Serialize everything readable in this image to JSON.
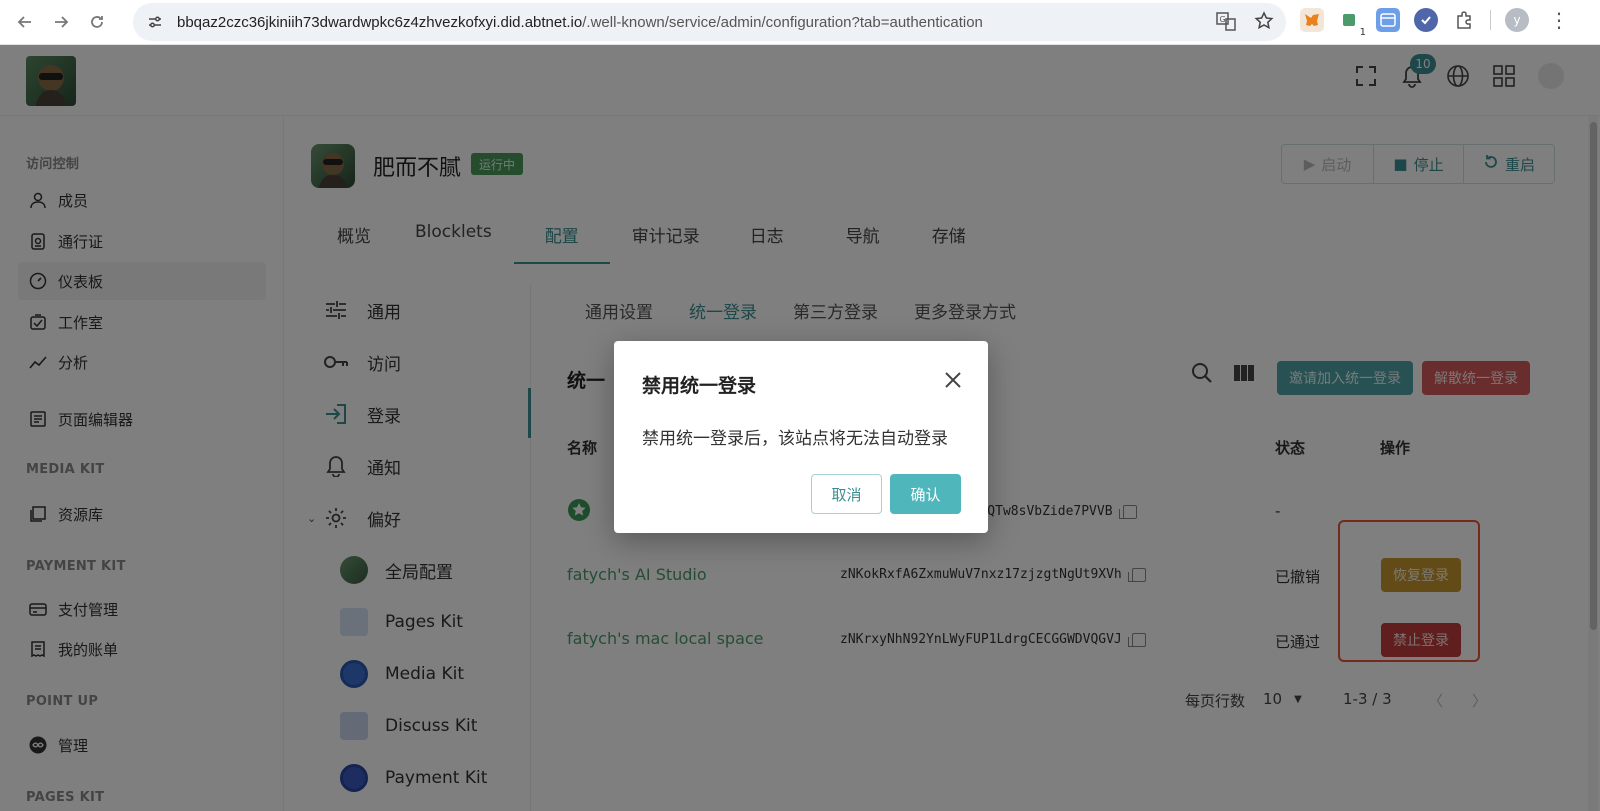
{
  "browser": {
    "url_host": "bbqaz2czc36jkiniih73dwardwpkc6z4zhvezkofxyi.did.abtnet.io",
    "url_path": "/.well-known/service/admin/configuration?tab=authentication",
    "profile_initial": "y",
    "ext_badge": "1"
  },
  "header": {
    "notification_count": "10"
  },
  "sidebar": {
    "sections": [
      {
        "title": "访问控制"
      },
      {
        "title": "MEDIA KIT"
      },
      {
        "title": "PAYMENT KIT"
      },
      {
        "title": "POINT UP"
      },
      {
        "title": "PAGES KIT"
      }
    ],
    "items": [
      {
        "label": "成员"
      },
      {
        "label": "通行证"
      },
      {
        "label": "仪表板"
      },
      {
        "label": "工作室"
      },
      {
        "label": "分析"
      },
      {
        "label": "页面编辑器"
      },
      {
        "label": "资源库"
      },
      {
        "label": "支付管理"
      },
      {
        "label": "我的账单"
      },
      {
        "label": "管理"
      }
    ]
  },
  "blocklet": {
    "title": "肥而不腻",
    "status": "运行中",
    "start_label": "启动",
    "stop_label": "停止",
    "restart_label": "重启"
  },
  "main_tabs": [
    {
      "label": "概览"
    },
    {
      "label": "Blocklets"
    },
    {
      "label": "配置"
    },
    {
      "label": "审计记录"
    },
    {
      "label": "日志"
    },
    {
      "label": "导航"
    },
    {
      "label": "存储"
    }
  ],
  "config_menu": {
    "items": [
      {
        "label": "通用"
      },
      {
        "label": "访问"
      },
      {
        "label": "登录"
      },
      {
        "label": "通知"
      },
      {
        "label": "偏好"
      }
    ],
    "sub_items": [
      {
        "label": "全局配置"
      },
      {
        "label": "Pages Kit"
      },
      {
        "label": "Media Kit"
      },
      {
        "label": "Discuss Kit"
      },
      {
        "label": "Payment Kit"
      }
    ]
  },
  "sub_tabs": [
    {
      "label": "通用设置"
    },
    {
      "label": "统一登录"
    },
    {
      "label": "第三方登录"
    },
    {
      "label": "更多登录方式"
    }
  ],
  "table": {
    "title_partial": "统一",
    "buttons": {
      "invite": "邀请加入统一登录",
      "dismiss": "解散统一登录"
    },
    "headers": {
      "name": "名称",
      "status": "状态",
      "actions": "操作"
    },
    "rows": [
      {
        "name": "",
        "did": "chXzQTw8sVbZide7PVVB",
        "status": "-",
        "action": ""
      },
      {
        "name": "fatych's AI Studio",
        "did": "zNKokRxfA6ZxmuWuV7nxz17zjzgtNgUt9XVh",
        "status": "已撤销",
        "action": "恢复登录"
      },
      {
        "name": "fatych's mac local space",
        "did": "zNKrxyNhN92YnLWyFUP1LdrgCECGGWDVQGVJ",
        "status": "已通过",
        "action": "禁止登录"
      }
    ],
    "pager": {
      "rows_per_page_label": "每页行数",
      "rows_per_page": "10",
      "range": "1-3 / 3"
    }
  },
  "modal": {
    "title": "禁用统一登录",
    "body": "禁用统一登录后，该站点将无法自动登录",
    "cancel": "取消",
    "confirm": "确认"
  }
}
